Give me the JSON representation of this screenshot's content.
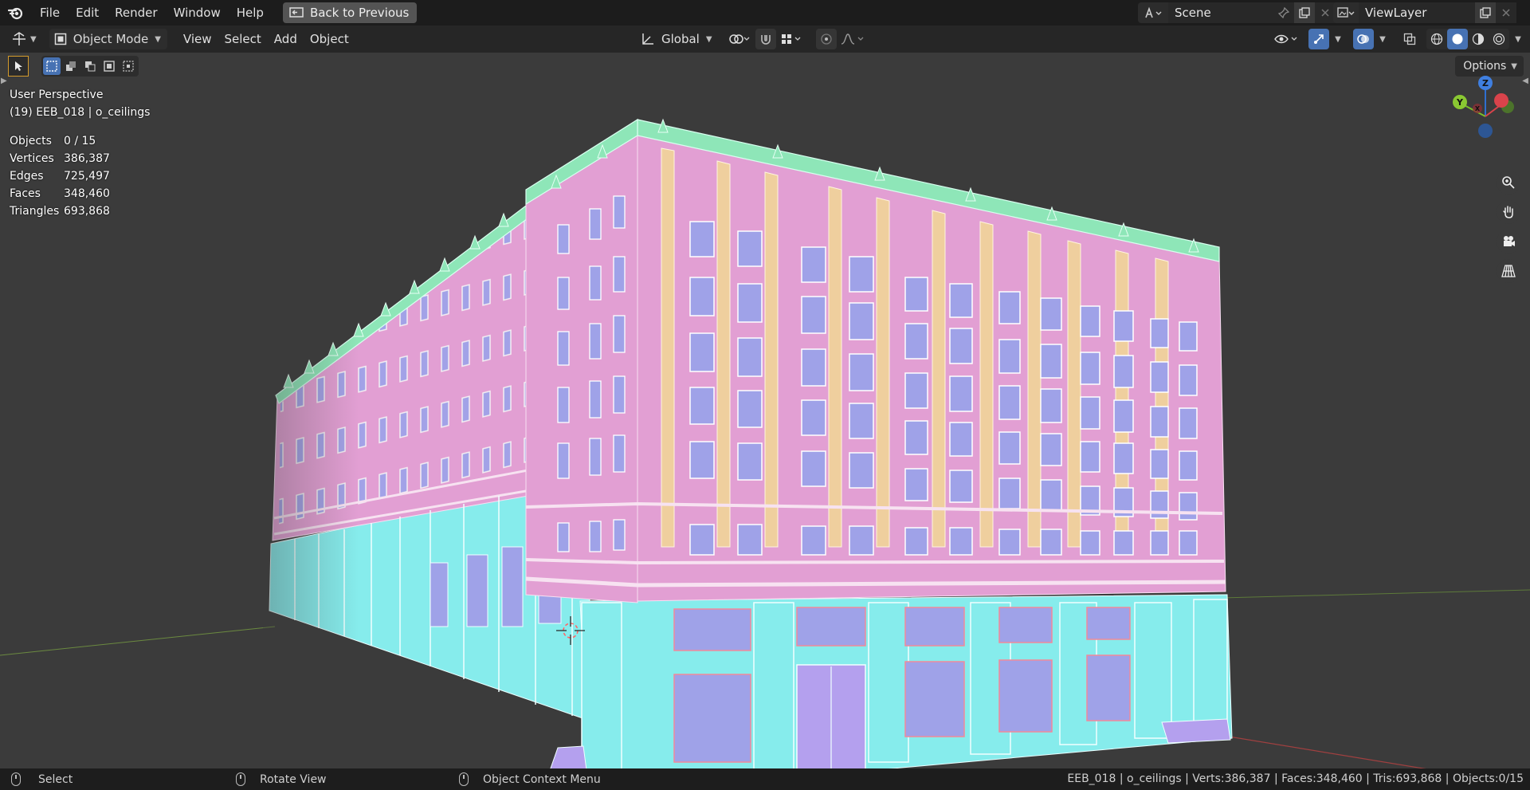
{
  "topbar": {
    "menu": [
      "File",
      "Edit",
      "Render",
      "Window",
      "Help"
    ],
    "back_label": "Back to Previous",
    "scene": "Scene",
    "view_layer": "ViewLayer"
  },
  "header": {
    "mode": "Object Mode",
    "menus": [
      "View",
      "Select",
      "Add",
      "Object"
    ],
    "transform_orientation": "Global",
    "options_label": "Options"
  },
  "viewport": {
    "perspective": "User Perspective",
    "object_info": "(19) EEB_018 | o_ceilings",
    "stats": [
      {
        "label": "Objects",
        "value": "0 / 15"
      },
      {
        "label": "Vertices",
        "value": "386,387"
      },
      {
        "label": "Edges",
        "value": "725,497"
      },
      {
        "label": "Faces",
        "value": "348,460"
      },
      {
        "label": "Triangles",
        "value": "693,868"
      }
    ],
    "gizmo": {
      "x": "X",
      "y": "Y",
      "z": "Z"
    },
    "colors": {
      "background": "#3b3b3b",
      "facade_pink": "#e29fd3",
      "pilaster_tan": "#efcf9e",
      "cornice_mint": "#8ee6b8",
      "ground_cyan": "#86ecec",
      "window_blue": "#9fa2e8",
      "door_lilac": "#b4a0ee"
    }
  },
  "statusbar": {
    "select": "Select",
    "rotate": "Rotate View",
    "context": "Object Context Menu",
    "info": "EEB_018 | o_ceilings | Verts:386,387 | Faces:348,460 | Tris:693,868 | Objects:0/15"
  }
}
